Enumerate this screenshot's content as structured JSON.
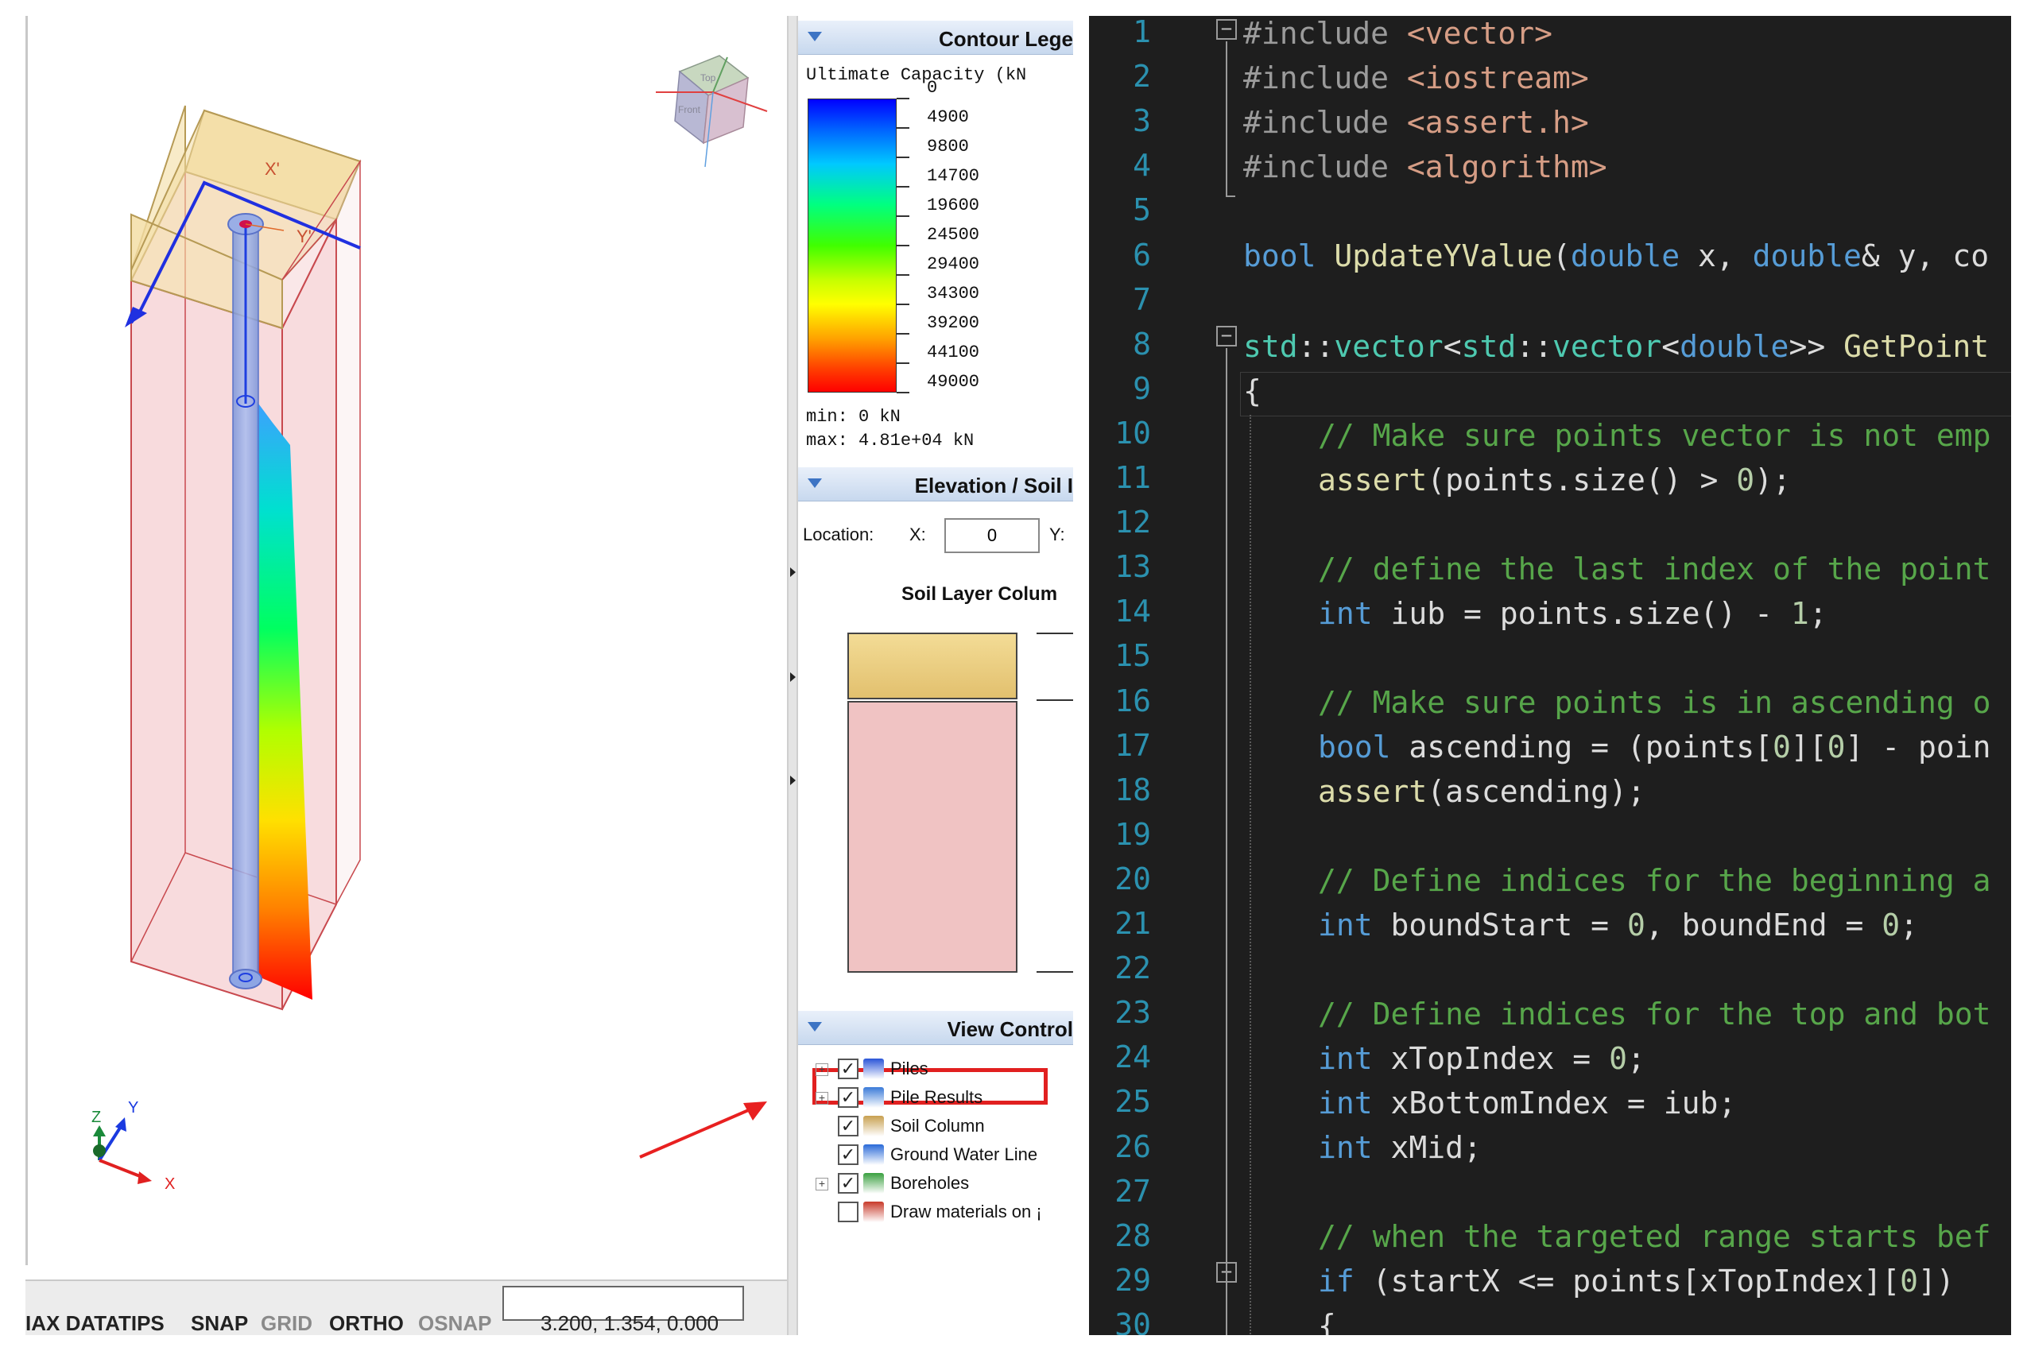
{
  "status_bar": {
    "items": [
      "IAX DATATIPS",
      "SNAP",
      "GRID",
      "ORTHO",
      "OSNAP"
    ],
    "coordinates": "3.200, 1.354, 0.000"
  },
  "viewport": {
    "local_axis_x": "X'",
    "local_axis_y": "Y'",
    "triad_x": "X",
    "triad_y": "Y",
    "triad_z": "Z",
    "cube_top": "Top",
    "cube_front": "Front"
  },
  "contour_legend": {
    "header": "Contour Lege",
    "title": "Ultimate Capacity (kN",
    "labels": [
      "0",
      "4900",
      "9800",
      "14700",
      "19600",
      "24500",
      "29400",
      "34300",
      "39200",
      "44100",
      "49000"
    ],
    "min": "min: 0 kN",
    "max": "max: 4.81e+04 kN"
  },
  "elevation_soil": {
    "header": "Elevation / Soil I",
    "location_label": "Location:",
    "x_label": "X:",
    "x_value": "0",
    "y_label": "Y:",
    "soil_column_title": "Soil Layer Colum"
  },
  "view_control": {
    "header": "View Control",
    "items": [
      {
        "label": "Piles",
        "checked": true,
        "expander": true
      },
      {
        "label": "Pile Results",
        "checked": true,
        "expander": true
      },
      {
        "label": "Soil Column",
        "checked": true,
        "expander": false
      },
      {
        "label": "Ground Water Line",
        "checked": true,
        "expander": false
      },
      {
        "label": "Boreholes",
        "checked": true,
        "expander": true
      },
      {
        "label": "Draw materials on ¡",
        "checked": false,
        "expander": false
      }
    ]
  },
  "editor": {
    "line_numbers": [
      "1",
      "2",
      "3",
      "4",
      "5",
      "6",
      "7",
      "8",
      "9",
      "10",
      "11",
      "12",
      "13",
      "14",
      "15",
      "16",
      "17",
      "18",
      "19",
      "20",
      "21",
      "22",
      "23",
      "24",
      "25",
      "26",
      "27",
      "28",
      "29",
      "30"
    ],
    "line1": "#include <vector>",
    "line2": "#include <iostream>",
    "line3": "#include <assert.h>",
    "line4": "#include <algorithm>",
    "line6": "bool UpdateYValue(double x, double& y, co",
    "line8": "std::vector<std::vector<double>> GetPoint",
    "line9": "{",
    "line10": "// Make sure points vector is not emp",
    "line11": "assert(points.size() > 0);",
    "line13": "// define the last index of the point",
    "line14": "int iub = points.size() - 1;",
    "line16": "// Make sure points is in ascending o",
    "line17": "bool ascending = (points[0][0] - poin",
    "line18": "assert(ascending);",
    "line20": "// Define indices for the beginning a",
    "line21": "int boundStart = 0, boundEnd = 0;",
    "line23": "// Define indices for the top and bot",
    "line24": "int xTopIndex = 0;",
    "line25": "int xBottomIndex = iub;",
    "line26": "int xMid;",
    "line28": "// when the targeted range starts bef",
    "line29": "if (startX <= points[xTopIndex][0])",
    "line30": "{"
  },
  "colors": {
    "editor_bg": "#1e1e1e",
    "line_number": "#2b91af",
    "keyword": "#569cd6",
    "comment": "#57a64a",
    "highlight": "#e12020",
    "pile_axis": "#1f3fe0"
  }
}
